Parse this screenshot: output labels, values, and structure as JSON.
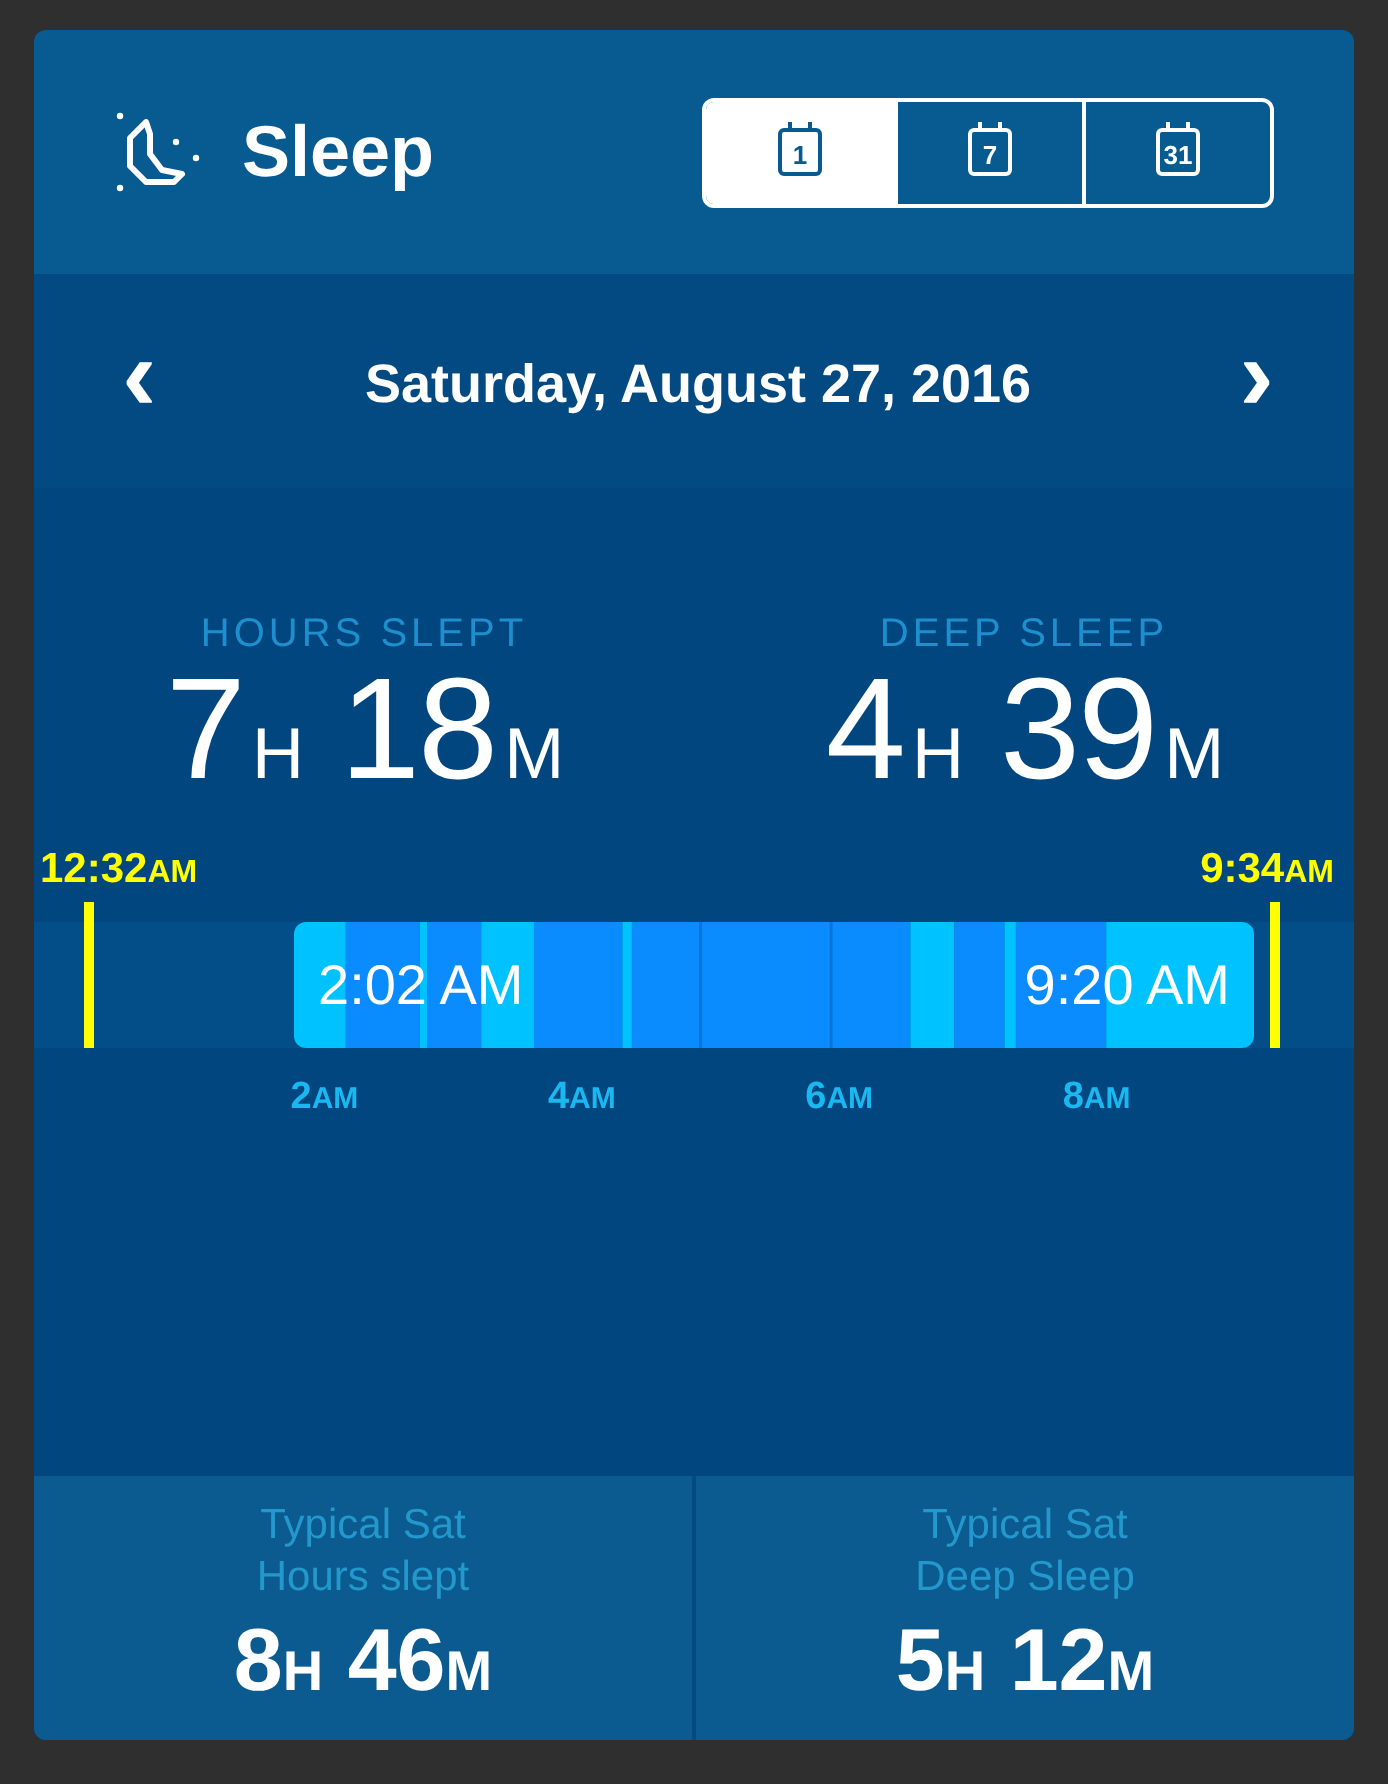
{
  "header": {
    "title": "Sleep"
  },
  "range_tabs": [
    {
      "label": "1",
      "selected": true
    },
    {
      "label": "7",
      "selected": false
    },
    {
      "label": "31",
      "selected": false
    }
  ],
  "date_nav": {
    "prev": "‹",
    "date": "Saturday, August 27, 2016",
    "next": "›"
  },
  "totals": [
    {
      "label": "HOURS SLEPT",
      "hours": "7",
      "hours_unit": "H",
      "minutes": "18",
      "minutes_unit": "M"
    },
    {
      "label": "DEEP SLEEP",
      "hours": "4",
      "hours_unit": "H",
      "minutes": "39",
      "minutes_unit": "M"
    }
  ],
  "timeline": {
    "bed_time": {
      "time": "12:32",
      "suffix": "AM"
    },
    "wake_time": {
      "time": "9:34",
      "suffix": "AM"
    },
    "sleep_start": "2:02 AM",
    "sleep_end": "9:20 AM",
    "ticks": [
      {
        "time": "2",
        "suffix": "AM"
      },
      {
        "time": "4",
        "suffix": "AM"
      },
      {
        "time": "6",
        "suffix": "AM"
      },
      {
        "time": "8",
        "suffix": "AM"
      }
    ]
  },
  "typical": [
    {
      "label": "Typical Sat",
      "sublabel": "Hours slept",
      "hours": "8",
      "hours_unit": "H",
      "minutes": "46",
      "minutes_unit": "M"
    },
    {
      "label": "Typical Sat",
      "sublabel": "Deep Sleep",
      "hours": "5",
      "hours_unit": "H",
      "minutes": "12",
      "minutes_unit": "M"
    }
  ]
}
